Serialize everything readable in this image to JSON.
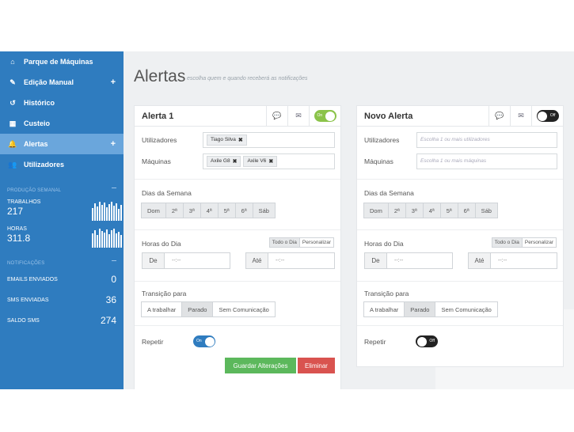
{
  "sidebar": {
    "items": [
      {
        "label": "Parque de Máquinas",
        "icon": "home-icon",
        "glyph": "⌂",
        "plus": ""
      },
      {
        "label": "Edição Manual",
        "icon": "edit-icon",
        "glyph": "✎",
        "plus": "+"
      },
      {
        "label": "Histórico",
        "icon": "history-icon",
        "glyph": "↺",
        "plus": ""
      },
      {
        "label": "Custeio",
        "icon": "calculator-icon",
        "glyph": "▦",
        "plus": ""
      },
      {
        "label": "Alertas",
        "icon": "bell-icon",
        "glyph": "🔔",
        "plus": "+"
      },
      {
        "label": "Utilizadores",
        "icon": "users-icon",
        "glyph": "👥",
        "plus": ""
      }
    ],
    "section_week": "PRODUÇÃO SEMANAL",
    "stats": [
      {
        "label": "TRABALHOS",
        "value": "217"
      },
      {
        "label": "HORAS",
        "value": "311.8"
      }
    ],
    "section_notif": "NOTIFICAÇÕES",
    "counts": [
      {
        "label": "EMAILS ENVIADOS",
        "value": "0"
      },
      {
        "label": "SMS ENVIADAS",
        "value": "36"
      },
      {
        "label": "SALDO SMS",
        "value": "274"
      }
    ]
  },
  "header": {
    "title": "Alertas",
    "subtitle": "escolha quem e quando receberá as notificações"
  },
  "alert1": {
    "title": "Alerta 1",
    "toggle_text": "On",
    "users_label": "Utilizadores",
    "users": [
      "Tiago Silva"
    ],
    "machines_label": "Máquinas",
    "machines": [
      "Axile G8",
      "Axile V6"
    ],
    "days_title": "Dias da Semana",
    "days": [
      "Dom",
      "2ª",
      "3ª",
      "4ª",
      "5ª",
      "6ª",
      "Sáb"
    ],
    "hours_title": "Horas do Dia",
    "all_day": "Todo o Dia",
    "custom": "Personalizar",
    "from_label": "De",
    "from_value": "--:--",
    "to_label": "Até",
    "to_value": "--:--",
    "transition_title": "Transição para",
    "transitions": [
      "A trabalhar",
      "Parado",
      "Sem Comunicação"
    ],
    "repeat_label": "Repetir",
    "repeat_toggle": "On",
    "save_label": "Guardar Alterações",
    "delete_label": "Eliminar"
  },
  "alert2": {
    "title": "Novo Alerta",
    "toggle_text": "Off",
    "users_label": "Utilizadores",
    "users_placeholder": "Escolha 1 ou mais utilizadores",
    "machines_label": "Máquinas",
    "machines_placeholder": "Escolha 1 ou mais máquinas",
    "days_title": "Dias da Semana",
    "days": [
      "Dom",
      "2ª",
      "3ª",
      "4ª",
      "5ª",
      "6ª",
      "Sáb"
    ],
    "hours_title": "Horas do Dia",
    "all_day": "Todo o Dia",
    "custom": "Personalizar",
    "from_label": "De",
    "from_value": "--:--",
    "to_label": "Até",
    "to_value": "--:--",
    "transition_title": "Transição para",
    "transitions": [
      "A trabalhar",
      "Parado",
      "Sem Comunicação"
    ],
    "repeat_label": "Repetir",
    "repeat_toggle": "Off"
  }
}
